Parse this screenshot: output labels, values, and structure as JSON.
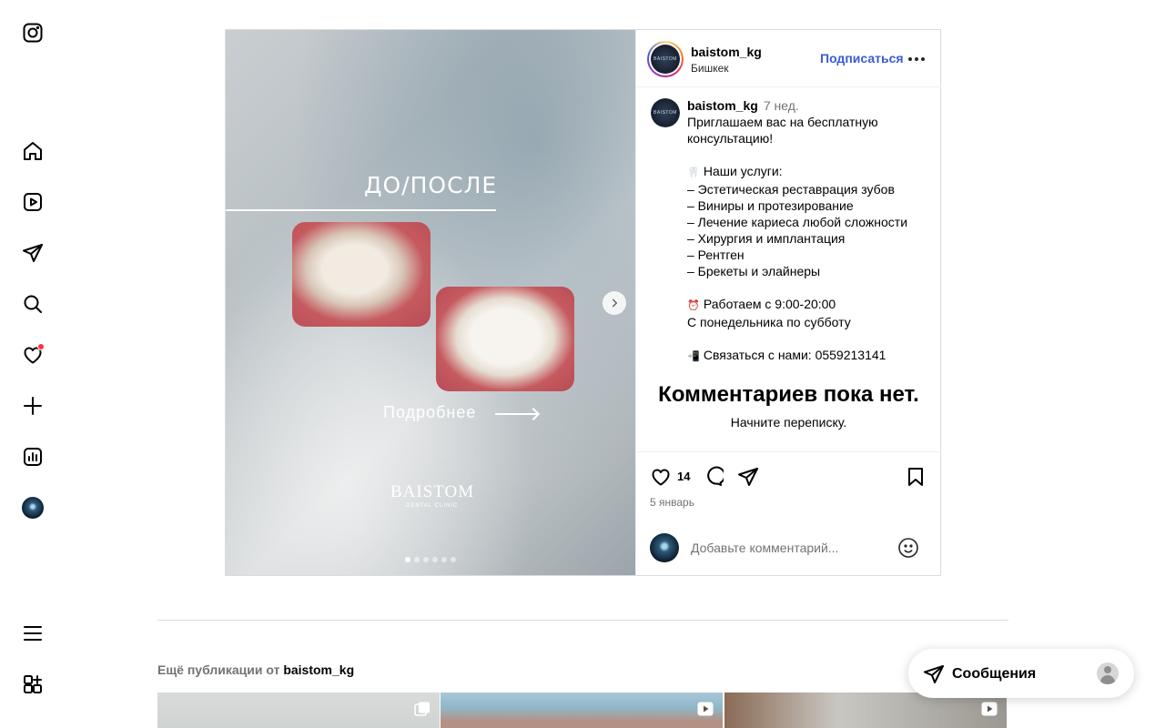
{
  "sidebar": {
    "items": [
      {
        "name": "instagram-logo-icon"
      },
      {
        "name": "home-icon"
      },
      {
        "name": "reels-icon"
      },
      {
        "name": "send-icon"
      },
      {
        "name": "search-icon"
      },
      {
        "name": "heart-icon"
      },
      {
        "name": "plus-icon"
      },
      {
        "name": "chart-icon"
      },
      {
        "name": "profile-avatar"
      },
      {
        "name": "menu-icon"
      },
      {
        "name": "apps-icon"
      }
    ]
  },
  "post": {
    "media": {
      "title": "ДО/ПОСЛЕ",
      "more": "Подробнее",
      "logo": "BAISTOM",
      "logo_sub": "DENTAL CLINIC",
      "slide_count": 6,
      "active_slide": 1
    },
    "header": {
      "username": "baistom_kg",
      "location": "Бишкек",
      "follow": "Подписаться",
      "avatar_text": "BAISTOM"
    },
    "caption": {
      "username": "baistom_kg",
      "time": "7 нед.",
      "intro": "Приглашаем вас на бесплатную консультацию!",
      "services_title": "Наши услуги:",
      "services": [
        "– Эстетическая реставрация зубов",
        "– Виниры и протезирование",
        "– Лечение кариеса любой сложности",
        "– Хирургия и имплантация",
        "– Рентген",
        "– Брекеты и элайнеры"
      ],
      "hours": "Работаем с 9:00-20:00",
      "days": "С понедельника по субботу",
      "contact": "Связаться с нами: 0559213141",
      "emoji_tooth": "🦷",
      "emoji_clock": "⏰",
      "emoji_phone": "📲"
    },
    "comments": {
      "empty_title": "Комментариев пока нет.",
      "empty_sub": "Начните переписку."
    },
    "actions": {
      "likes": "14",
      "date": "5 январь"
    },
    "comment_input": {
      "placeholder": "Добавьте комментарий..."
    }
  },
  "more_posts": {
    "label": "Ещё публикации от",
    "username": "baistom_kg"
  },
  "messages": {
    "label": "Сообщения"
  },
  "colors": {
    "follow": "#3c5ad7",
    "notification": "#ff3040"
  }
}
